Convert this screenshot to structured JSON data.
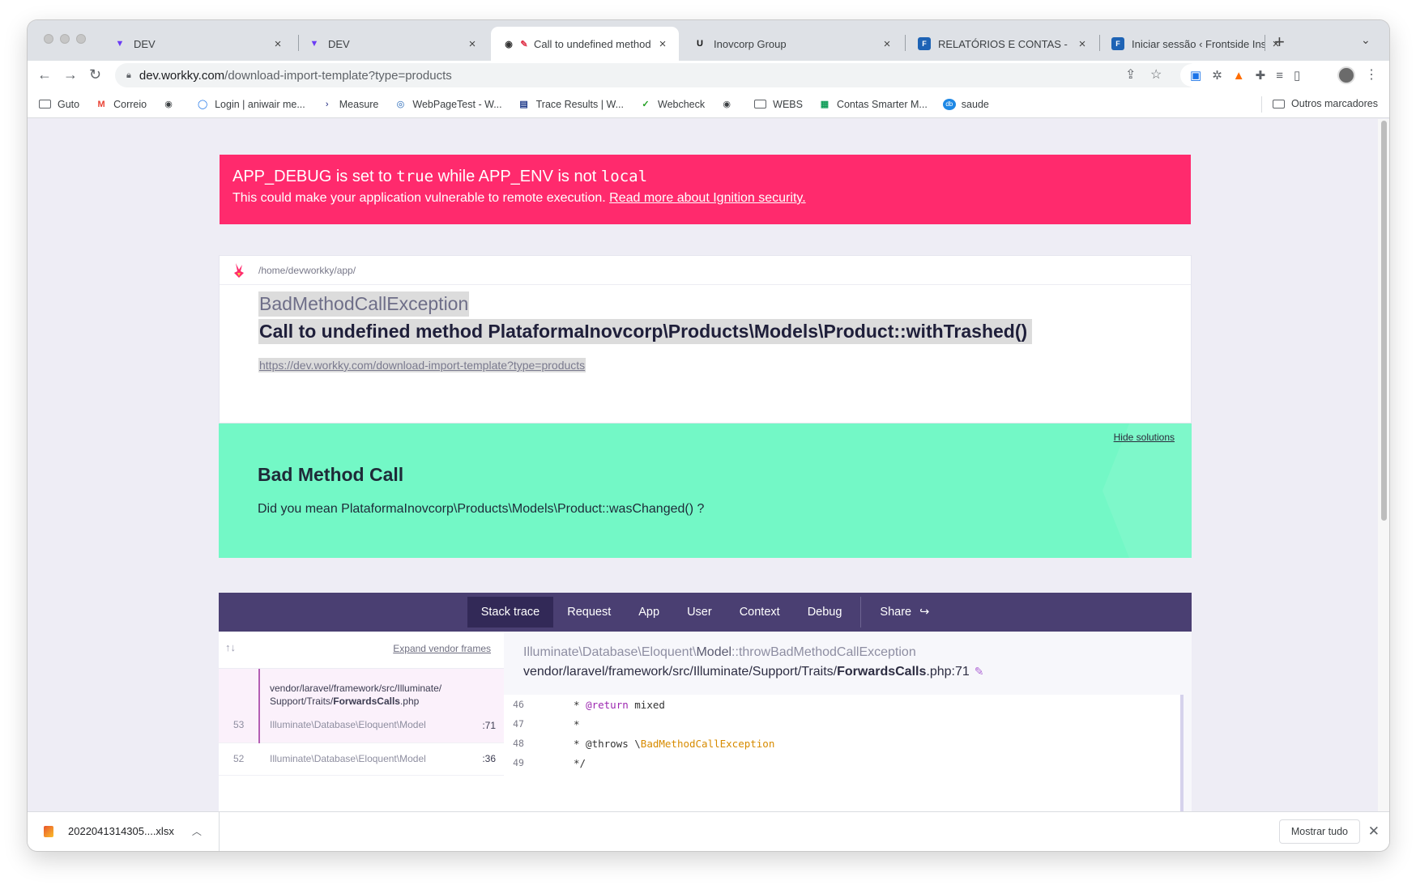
{
  "browser": {
    "tabs": [
      {
        "title": "DEV",
        "favicon": "workky-icon"
      },
      {
        "title": "DEV",
        "favicon": "workky-icon"
      },
      {
        "title": "Call to undefined method P",
        "favicon": "ignition-icon",
        "active": true
      },
      {
        "title": "Inovcorp Group",
        "favicon": "inovcorp-icon"
      },
      {
        "title": "RELATÓRIOS E CONTAS - Fron",
        "favicon": "frontside-icon"
      },
      {
        "title": "Iniciar sessão ‹ Frontside Insur",
        "favicon": "frontside-icon"
      }
    ],
    "url_host": "dev.workky.com",
    "url_path": "/download-import-template?type=products",
    "bookmarks": [
      {
        "label": "Guto",
        "icon": "folder-icon"
      },
      {
        "label": "Correio",
        "icon": "gmail-icon"
      },
      {
        "label": "",
        "icon": "globe-icon"
      },
      {
        "label": "Login | aniwair me...",
        "icon": "chat-icon"
      },
      {
        "label": "Measure",
        "icon": "measure-icon"
      },
      {
        "label": "WebPageTest - W...",
        "icon": "webpagetest-icon"
      },
      {
        "label": "Trace Results | W...",
        "icon": "trace-icon"
      },
      {
        "label": "Webcheck",
        "icon": "check-icon"
      },
      {
        "label": "",
        "icon": "globe-icon"
      },
      {
        "label": "WEBS",
        "icon": "folder-icon"
      },
      {
        "label": "Contas Smarter M...",
        "icon": "sheets-icon"
      },
      {
        "label": "saude",
        "icon": "db-icon"
      }
    ],
    "other_bookmarks": "Outros marcadores"
  },
  "warning": {
    "app_debug": "APP_DEBUG",
    "is_set_to": " is set to ",
    "true_value": "true",
    "while": " while ",
    "app_env": "APP_ENV",
    "is_not": " is not ",
    "local_value": "local",
    "message": "This could make your application vulnerable to remote execution. ",
    "link": "Read more about Ignition security."
  },
  "error": {
    "path": "/home/devworkky/app/",
    "class": "BadMethodCallException",
    "message": "Call to undefined method PlataformaInovcorp\\Products\\Models\\Product::withTrashed()",
    "url": "https://dev.workky.com/download-import-template?type=products"
  },
  "solution": {
    "hide_label": "Hide solutions",
    "title": "Bad Method Call",
    "text": "Did you mean PlataformaInovcorp\\Products\\Models\\Product::wasChanged() ?"
  },
  "tabs": [
    "Stack trace",
    "Request",
    "App",
    "User",
    "Context",
    "Debug"
  ],
  "share_label": "Share",
  "stack": {
    "expand_label": "Expand vendor frames",
    "selected_file_prefix": "vendor/laravel/framework/src/Illuminate/",
    "selected_file_dir": "Support/Traits/",
    "selected_file_name": "ForwardsCalls",
    "selected_file_ext": ".php",
    "frames": [
      {
        "num": "53",
        "cls": "Illuminate\\Database\\Eloquent\\Model",
        "line": ":71"
      },
      {
        "num": "52",
        "cls": "Illuminate\\Database\\Eloquent\\Model",
        "line": ":36"
      }
    ],
    "detail_ns": "Illuminate\\Database\\Eloquent\\",
    "detail_cls": "Model",
    "detail_method": "::throwBadMethodCallException",
    "detail_path_prefix": "vendor/laravel/framework/src/Illuminate/Support/Traits/",
    "detail_file": "ForwardsCalls",
    "detail_ext_line": ".php:71",
    "code": [
      {
        "ln": "46",
        "pre": "* ",
        "tag": "@return",
        "post": " mixed"
      },
      {
        "ln": "47",
        "pre": "*",
        "tag": "",
        "post": ""
      },
      {
        "ln": "48",
        "pre": "* @throws \\",
        "tag": "BadMethodCallException",
        "post": ""
      },
      {
        "ln": "49",
        "pre": "*/",
        "tag": "",
        "post": ""
      }
    ]
  },
  "downloads": {
    "file": "2022041314305....xlsx",
    "show_all": "Mostrar tudo"
  }
}
